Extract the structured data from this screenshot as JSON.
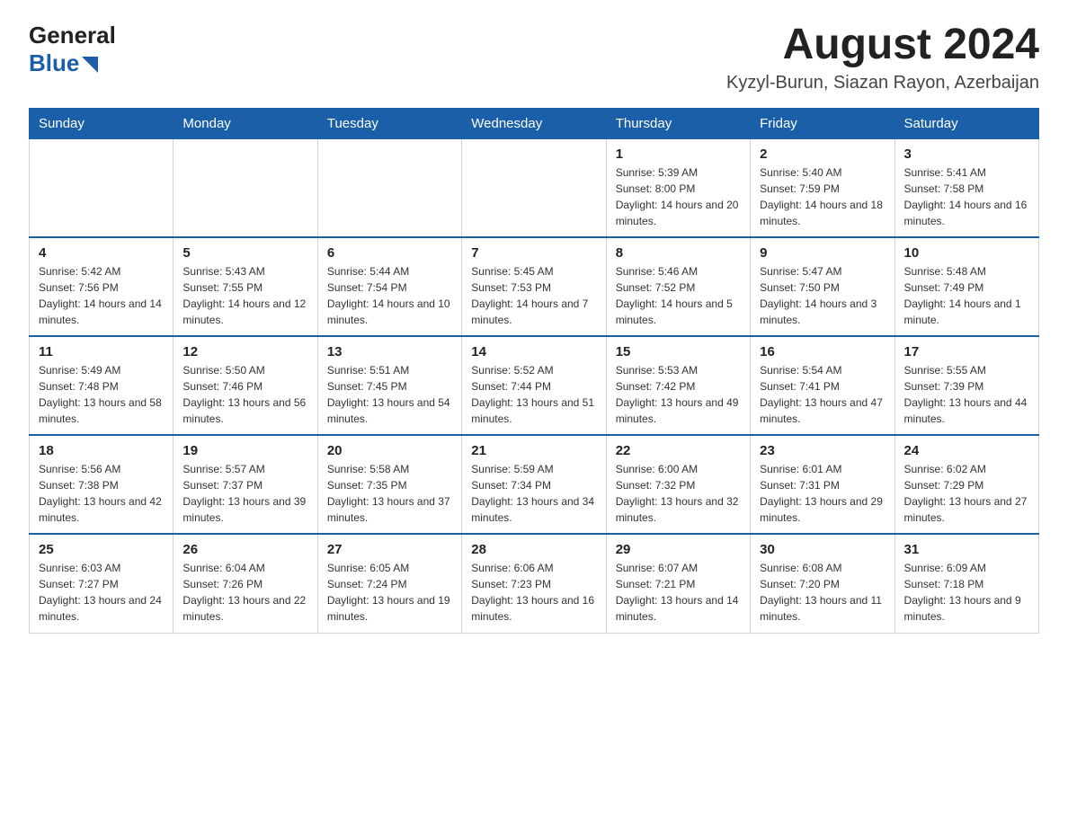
{
  "header": {
    "logo_line1": "General",
    "logo_line2": "Blue",
    "month_title": "August 2024",
    "location": "Kyzyl-Burun, Siazan Rayon, Azerbaijan"
  },
  "days_of_week": [
    "Sunday",
    "Monday",
    "Tuesday",
    "Wednesday",
    "Thursday",
    "Friday",
    "Saturday"
  ],
  "weeks": [
    [
      {
        "day": "",
        "info": ""
      },
      {
        "day": "",
        "info": ""
      },
      {
        "day": "",
        "info": ""
      },
      {
        "day": "",
        "info": ""
      },
      {
        "day": "1",
        "info": "Sunrise: 5:39 AM\nSunset: 8:00 PM\nDaylight: 14 hours and 20 minutes."
      },
      {
        "day": "2",
        "info": "Sunrise: 5:40 AM\nSunset: 7:59 PM\nDaylight: 14 hours and 18 minutes."
      },
      {
        "day": "3",
        "info": "Sunrise: 5:41 AM\nSunset: 7:58 PM\nDaylight: 14 hours and 16 minutes."
      }
    ],
    [
      {
        "day": "4",
        "info": "Sunrise: 5:42 AM\nSunset: 7:56 PM\nDaylight: 14 hours and 14 minutes."
      },
      {
        "day": "5",
        "info": "Sunrise: 5:43 AM\nSunset: 7:55 PM\nDaylight: 14 hours and 12 minutes."
      },
      {
        "day": "6",
        "info": "Sunrise: 5:44 AM\nSunset: 7:54 PM\nDaylight: 14 hours and 10 minutes."
      },
      {
        "day": "7",
        "info": "Sunrise: 5:45 AM\nSunset: 7:53 PM\nDaylight: 14 hours and 7 minutes."
      },
      {
        "day": "8",
        "info": "Sunrise: 5:46 AM\nSunset: 7:52 PM\nDaylight: 14 hours and 5 minutes."
      },
      {
        "day": "9",
        "info": "Sunrise: 5:47 AM\nSunset: 7:50 PM\nDaylight: 14 hours and 3 minutes."
      },
      {
        "day": "10",
        "info": "Sunrise: 5:48 AM\nSunset: 7:49 PM\nDaylight: 14 hours and 1 minute."
      }
    ],
    [
      {
        "day": "11",
        "info": "Sunrise: 5:49 AM\nSunset: 7:48 PM\nDaylight: 13 hours and 58 minutes."
      },
      {
        "day": "12",
        "info": "Sunrise: 5:50 AM\nSunset: 7:46 PM\nDaylight: 13 hours and 56 minutes."
      },
      {
        "day": "13",
        "info": "Sunrise: 5:51 AM\nSunset: 7:45 PM\nDaylight: 13 hours and 54 minutes."
      },
      {
        "day": "14",
        "info": "Sunrise: 5:52 AM\nSunset: 7:44 PM\nDaylight: 13 hours and 51 minutes."
      },
      {
        "day": "15",
        "info": "Sunrise: 5:53 AM\nSunset: 7:42 PM\nDaylight: 13 hours and 49 minutes."
      },
      {
        "day": "16",
        "info": "Sunrise: 5:54 AM\nSunset: 7:41 PM\nDaylight: 13 hours and 47 minutes."
      },
      {
        "day": "17",
        "info": "Sunrise: 5:55 AM\nSunset: 7:39 PM\nDaylight: 13 hours and 44 minutes."
      }
    ],
    [
      {
        "day": "18",
        "info": "Sunrise: 5:56 AM\nSunset: 7:38 PM\nDaylight: 13 hours and 42 minutes."
      },
      {
        "day": "19",
        "info": "Sunrise: 5:57 AM\nSunset: 7:37 PM\nDaylight: 13 hours and 39 minutes."
      },
      {
        "day": "20",
        "info": "Sunrise: 5:58 AM\nSunset: 7:35 PM\nDaylight: 13 hours and 37 minutes."
      },
      {
        "day": "21",
        "info": "Sunrise: 5:59 AM\nSunset: 7:34 PM\nDaylight: 13 hours and 34 minutes."
      },
      {
        "day": "22",
        "info": "Sunrise: 6:00 AM\nSunset: 7:32 PM\nDaylight: 13 hours and 32 minutes."
      },
      {
        "day": "23",
        "info": "Sunrise: 6:01 AM\nSunset: 7:31 PM\nDaylight: 13 hours and 29 minutes."
      },
      {
        "day": "24",
        "info": "Sunrise: 6:02 AM\nSunset: 7:29 PM\nDaylight: 13 hours and 27 minutes."
      }
    ],
    [
      {
        "day": "25",
        "info": "Sunrise: 6:03 AM\nSunset: 7:27 PM\nDaylight: 13 hours and 24 minutes."
      },
      {
        "day": "26",
        "info": "Sunrise: 6:04 AM\nSunset: 7:26 PM\nDaylight: 13 hours and 22 minutes."
      },
      {
        "day": "27",
        "info": "Sunrise: 6:05 AM\nSunset: 7:24 PM\nDaylight: 13 hours and 19 minutes."
      },
      {
        "day": "28",
        "info": "Sunrise: 6:06 AM\nSunset: 7:23 PM\nDaylight: 13 hours and 16 minutes."
      },
      {
        "day": "29",
        "info": "Sunrise: 6:07 AM\nSunset: 7:21 PM\nDaylight: 13 hours and 14 minutes."
      },
      {
        "day": "30",
        "info": "Sunrise: 6:08 AM\nSunset: 7:20 PM\nDaylight: 13 hours and 11 minutes."
      },
      {
        "day": "31",
        "info": "Sunrise: 6:09 AM\nSunset: 7:18 PM\nDaylight: 13 hours and 9 minutes."
      }
    ]
  ]
}
